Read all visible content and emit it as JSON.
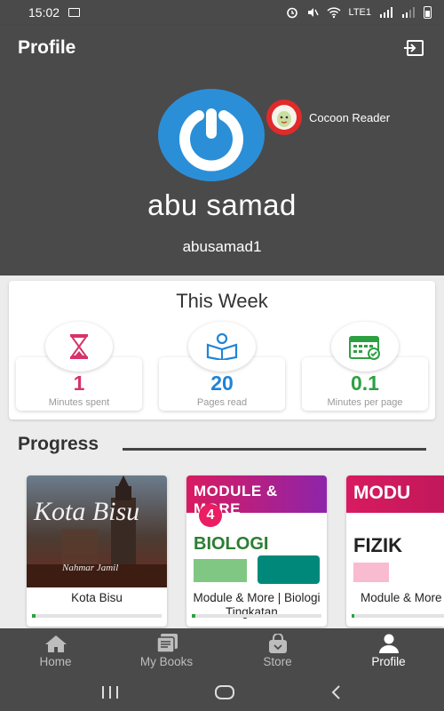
{
  "status_bar": {
    "time": "15:02",
    "network_label": "LTE1"
  },
  "app_bar": {
    "title": "Profile"
  },
  "profile": {
    "full_name": "abu samad",
    "username": "abusamad1",
    "badge_name": "Cocoon Reader"
  },
  "this_week": {
    "title": "This Week",
    "stats": [
      {
        "value": "1",
        "label": "Minutes spent",
        "color": "#d6336c",
        "icon": "hourglass-icon"
      },
      {
        "value": "20",
        "label": "Pages read",
        "color": "#1f84d6",
        "icon": "reading-person-icon"
      },
      {
        "value": "0.1",
        "label": "Minutes per page",
        "color": "#2ea043",
        "icon": "calendar-icon"
      }
    ]
  },
  "progress": {
    "title": "Progress",
    "books": [
      {
        "title": "Kota Bisu",
        "cover_title": "Kota Bisu",
        "cover_author": "Nahmar Jamil",
        "progress": 0.03
      },
      {
        "title": "Module & More | Biologi Tingkatan...",
        "cover_title": "MODULE & MORE",
        "cover_subject": "BIOLOGI",
        "cover_form": "4",
        "progress": 0.03
      },
      {
        "title": "Module & More | Fizik Tingkatan...",
        "cover_title": "MODU",
        "cover_subject": "FIZIK",
        "progress": 0.03
      }
    ]
  },
  "bottom_nav": {
    "items": [
      {
        "label": "Home",
        "icon": "home-icon",
        "active": false
      },
      {
        "label": "My Books",
        "icon": "books-icon",
        "active": false
      },
      {
        "label": "Store",
        "icon": "store-bag-icon",
        "active": false
      },
      {
        "label": "Profile",
        "icon": "person-icon",
        "active": true
      }
    ]
  },
  "colors": {
    "bar": "#4a4a4a",
    "avatar_blue": "#2b8fd8",
    "badge_red": "#e22a2a"
  }
}
